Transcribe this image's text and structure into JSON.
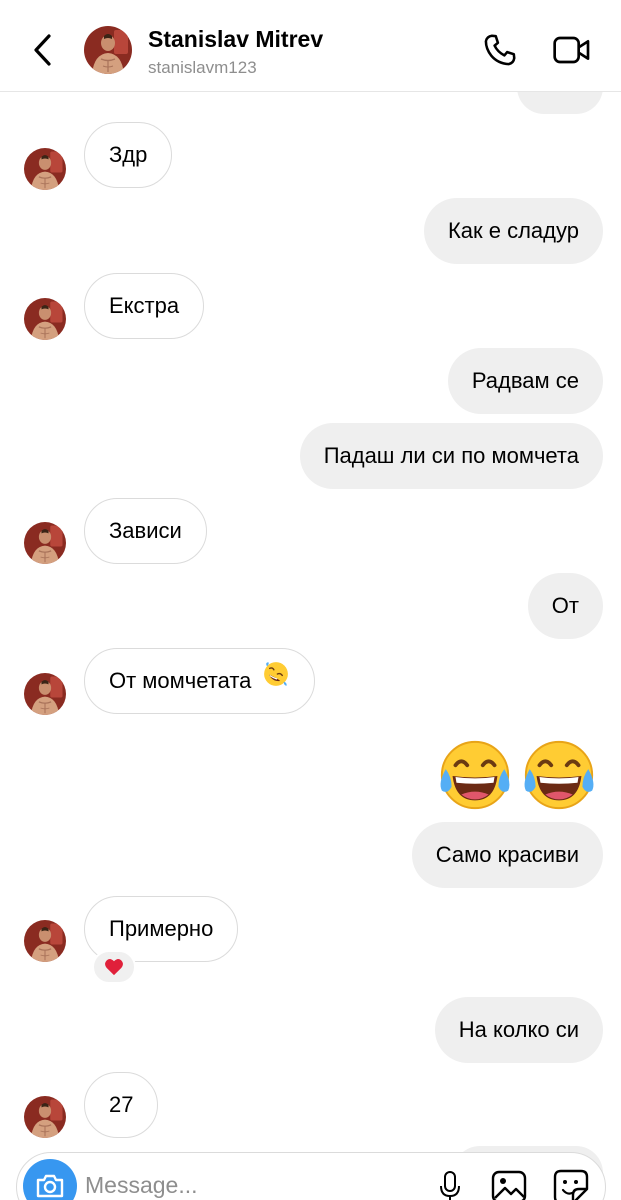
{
  "header": {
    "name": "Stanislav Mitrev",
    "username": "stanislavm123"
  },
  "messages": [
    {
      "side": "in",
      "text": "Здр"
    },
    {
      "side": "out",
      "text": "Как е сладур"
    },
    {
      "side": "in",
      "text": "Екстра"
    },
    {
      "side": "out",
      "text": "Радвам се"
    },
    {
      "side": "out",
      "text": "Падаш ли си по момчета"
    },
    {
      "side": "in",
      "text": "Зависи"
    },
    {
      "side": "out",
      "text": "От"
    },
    {
      "side": "in",
      "text": "От момчетата",
      "emoji": "rolling-on-floor-laughing"
    },
    {
      "side": "out",
      "text": "",
      "emoji": "two face-with-tears-of-joy emojis"
    },
    {
      "side": "out",
      "text": "Само красиви"
    },
    {
      "side": "in",
      "text": "Примерно",
      "reaction": "❤️"
    },
    {
      "side": "out",
      "text": "На колко си"
    },
    {
      "side": "in",
      "text": "27"
    }
  ],
  "composer": {
    "placeholder": "Message..."
  },
  "icons": {
    "back": "chevron-left-icon",
    "call": "phone-icon",
    "video": "video-camera-icon",
    "camera": "camera-icon",
    "mic": "microphone-icon",
    "gallery": "image-icon",
    "sticker": "sticker-icon"
  },
  "colors": {
    "outgoing_bubble": "#efefef",
    "incoming_border": "#dbdbdb",
    "camera_button": "#3797f0",
    "secondary_text": "#8e8e8e",
    "reaction_heart": "#e0203a"
  }
}
